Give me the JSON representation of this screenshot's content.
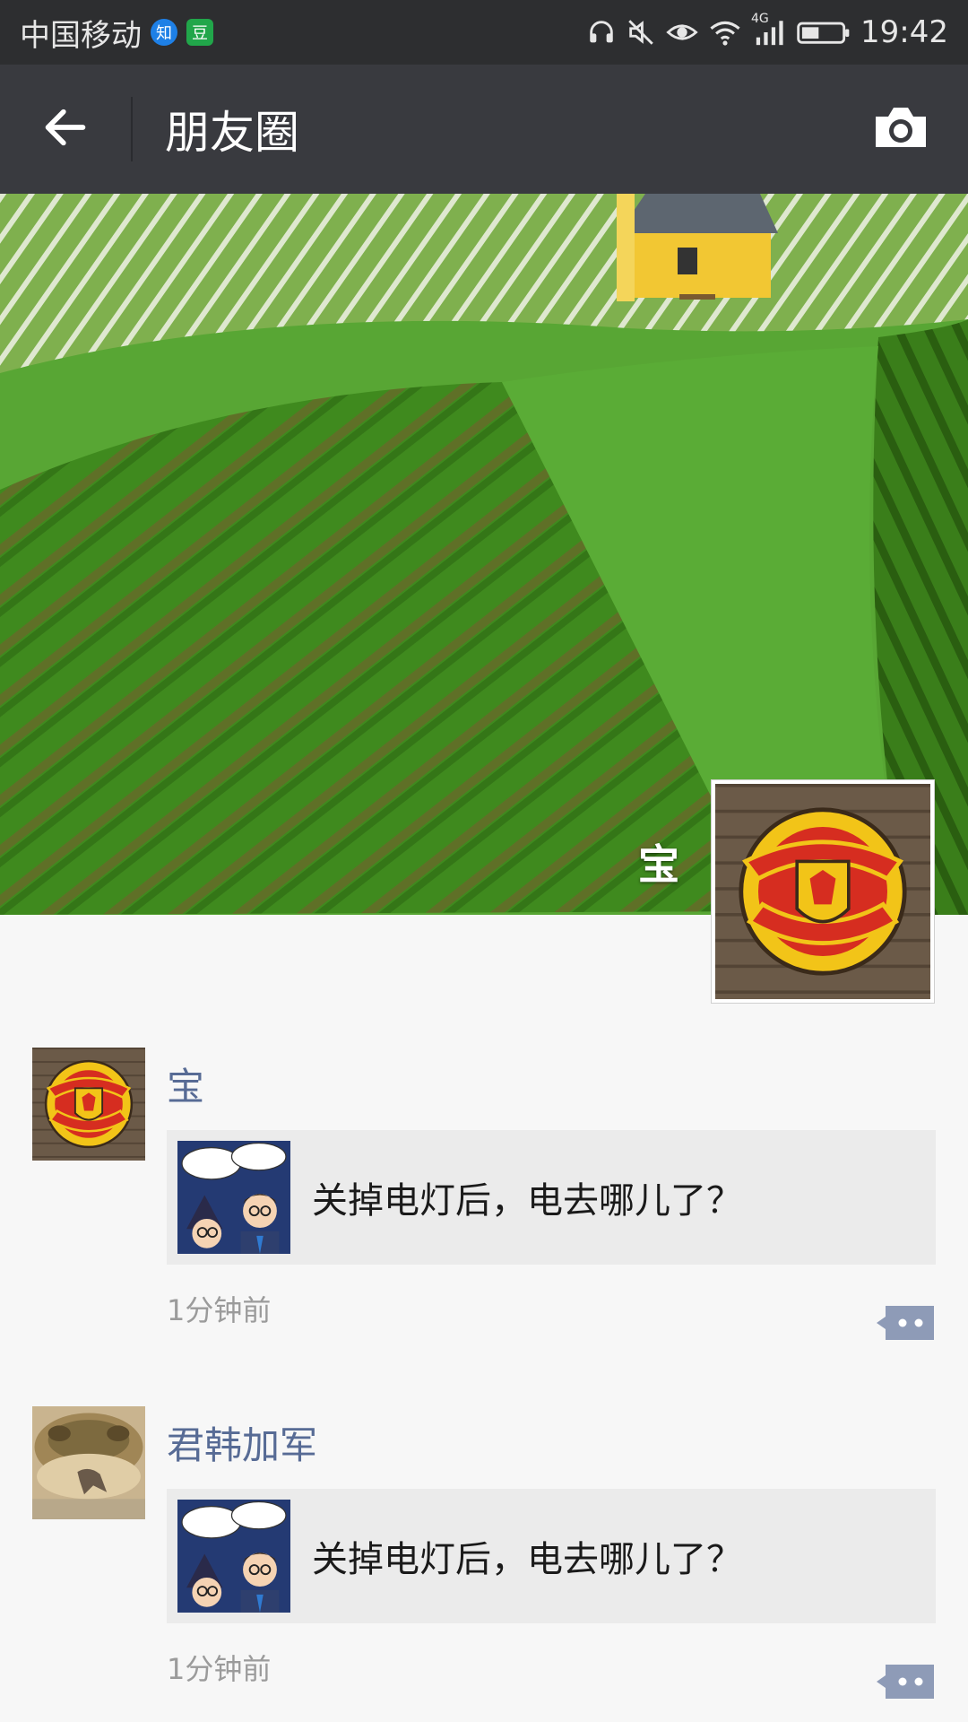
{
  "status_bar": {
    "carrier": "中国移动",
    "badges": [
      {
        "icon": "zhihu-app-icon",
        "text": "知",
        "color": "#1e80e6"
      },
      {
        "icon": "douban-app-icon",
        "text": "豆",
        "color": "#21a64a"
      }
    ],
    "icons": [
      "headphones-icon",
      "mute-icon",
      "eye-icon",
      "wifi-icon",
      "signal-4g-icon",
      "battery-icon"
    ],
    "network": "4G",
    "time": "19:42"
  },
  "header": {
    "title": "朋友圈",
    "back_icon": "back-arrow-icon",
    "camera_icon": "camera-icon"
  },
  "profile": {
    "name": "宝",
    "cover": "vineyard-cover-image",
    "avatar": "manchester-united-crest-avatar"
  },
  "feed": [
    {
      "name": "宝",
      "avatar": "manchester-united-crest-avatar",
      "share_text": "关掉电灯后，电去哪儿了？",
      "time": "1分钟前"
    },
    {
      "name": "君韩加军",
      "avatar": "frog-avatar",
      "share_text": "关掉电灯后，电去哪儿了？",
      "time": "1分钟前"
    }
  ],
  "colors": {
    "status_bar_bg": "#2d2e30",
    "title_bar_bg": "#393a3f",
    "name_link": "#576b95",
    "page_bg": "#f7f7f7",
    "card_bg": "#ebebeb"
  }
}
